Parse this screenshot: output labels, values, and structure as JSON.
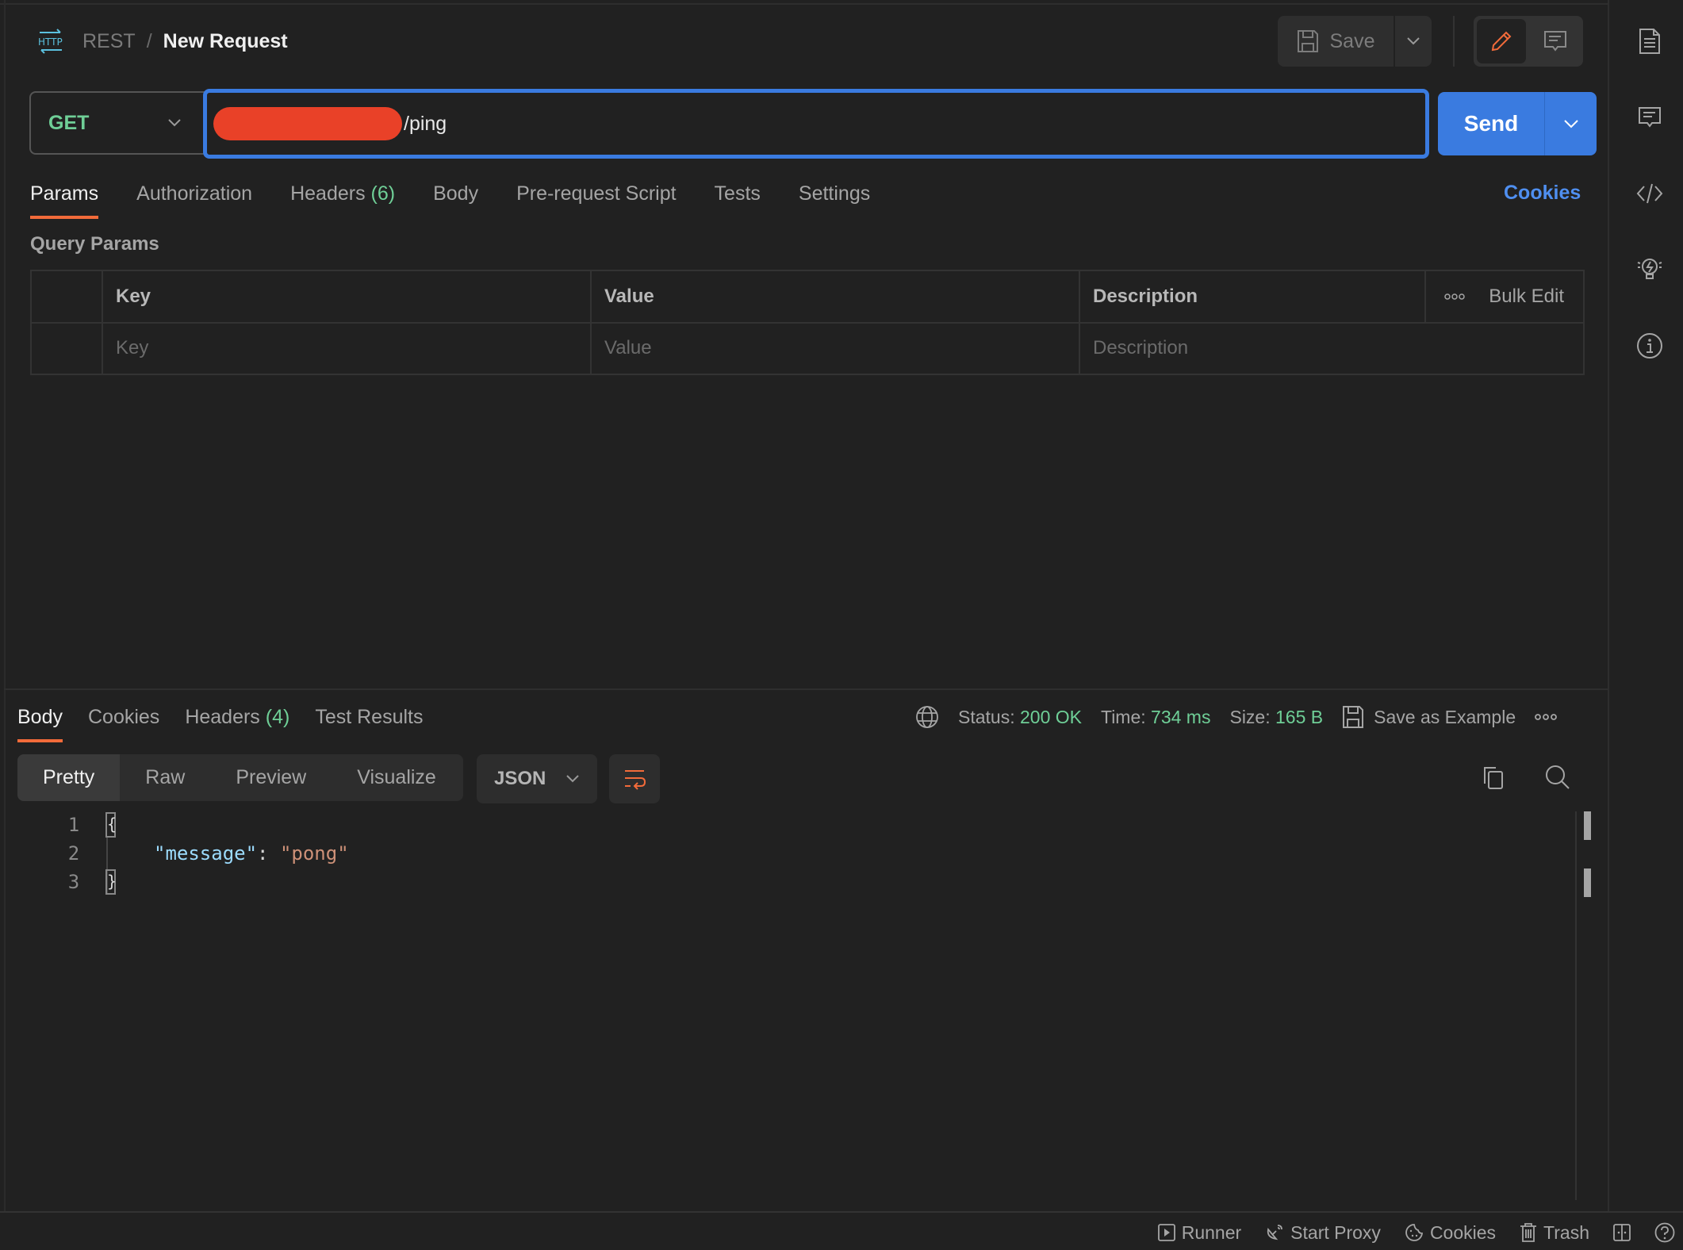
{
  "header": {
    "protocol_icon": "http-icon",
    "breadcrumb_root": "REST",
    "breadcrumb_separator": "/",
    "title": "New Request",
    "save_label": "Save"
  },
  "request": {
    "method": "GET",
    "url_visible": "/ping",
    "url_redacted": true,
    "send_label": "Send"
  },
  "request_tabs": [
    {
      "label": "Params",
      "count": null,
      "active": true
    },
    {
      "label": "Authorization",
      "count": null
    },
    {
      "label": "Headers",
      "count": "(6)"
    },
    {
      "label": "Body",
      "count": null
    },
    {
      "label": "Pre-request Script",
      "count": null
    },
    {
      "label": "Tests",
      "count": null
    },
    {
      "label": "Settings",
      "count": null
    }
  ],
  "cookies_link": "Cookies",
  "query_params": {
    "title": "Query Params",
    "columns": [
      "Key",
      "Value",
      "Description"
    ],
    "bulk_edit": "Bulk Edit",
    "placeholders": {
      "key": "Key",
      "value": "Value",
      "description": "Description"
    }
  },
  "response": {
    "tabs": [
      {
        "label": "Body",
        "active": true
      },
      {
        "label": "Cookies"
      },
      {
        "label": "Headers",
        "count": "(4)"
      },
      {
        "label": "Test Results"
      }
    ],
    "status_label": "Status:",
    "status_value": "200 OK",
    "time_label": "Time:",
    "time_value": "734 ms",
    "size_label": "Size:",
    "size_value": "165 B",
    "save_example": "Save as Example",
    "formats": [
      "Pretty",
      "Raw",
      "Preview",
      "Visualize"
    ],
    "active_format": "Pretty",
    "language": "JSON",
    "code_lines": [
      {
        "n": "1",
        "text": "{"
      },
      {
        "n": "2",
        "key": "\"message\"",
        "colon": ": ",
        "value": "\"pong\""
      },
      {
        "n": "3",
        "text": "}"
      }
    ]
  },
  "status_bar": {
    "runner": "Runner",
    "proxy": "Start Proxy",
    "cookies": "Cookies",
    "trash": "Trash"
  },
  "colors": {
    "accent_blue": "#3a7be0",
    "accent_orange": "#f26b3a",
    "success_green": "#6fcf97",
    "redaction_red": "#e94128"
  }
}
